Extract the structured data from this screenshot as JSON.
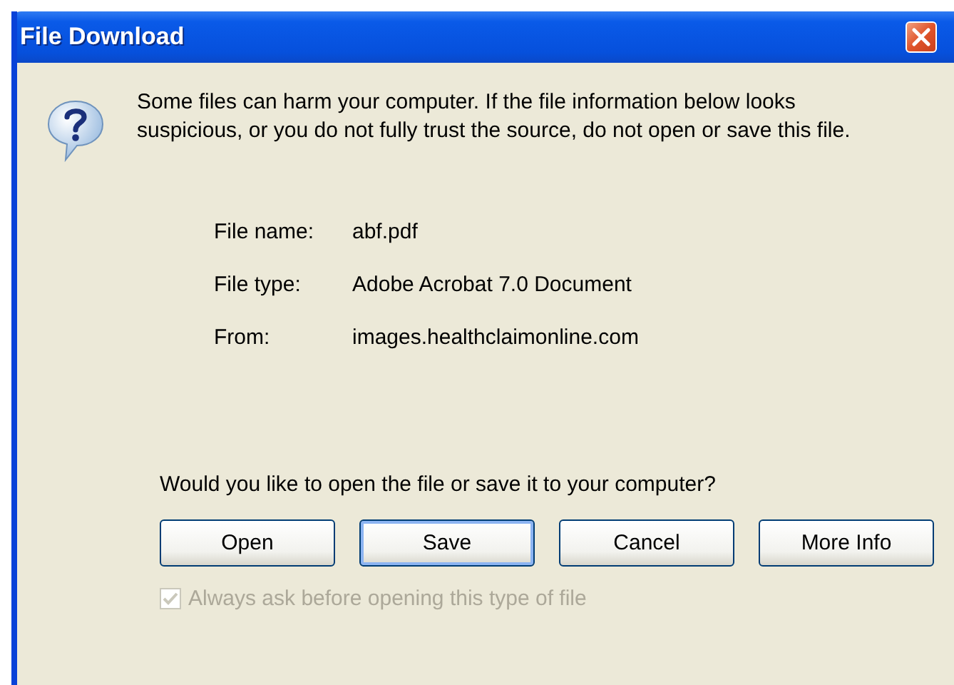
{
  "window": {
    "title": "File Download"
  },
  "warning": "Some files can harm your computer. If the file information below looks suspicious, or you do not fully trust the source, do not open or save this file.",
  "file_info": [
    {
      "label": "File name:",
      "value": "abf.pdf"
    },
    {
      "label": "File type:",
      "value": "Adobe Acrobat 7.0 Document"
    },
    {
      "label": "From:",
      "value": "images.healthclaimonline.com"
    }
  ],
  "question": "Would you like to open the file or save it to your computer?",
  "buttons": [
    {
      "label": "Open",
      "default": false
    },
    {
      "label": "Save",
      "default": true
    },
    {
      "label": "Cancel",
      "default": false
    },
    {
      "label": "More Info",
      "default": false
    }
  ],
  "always_ask": {
    "label": "Always ask before opening this type of file",
    "checked": true,
    "disabled": true
  }
}
